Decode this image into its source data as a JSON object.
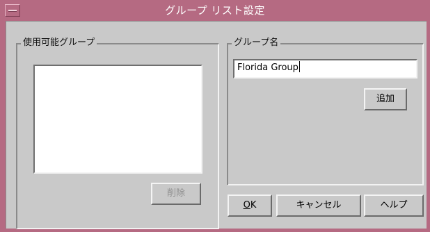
{
  "window": {
    "title": "グループ リスト設定"
  },
  "available_groups": {
    "label": "使用可能グループ",
    "items": [],
    "delete_label": "削除"
  },
  "group_name": {
    "label": "グループ名",
    "value": "Florida Group",
    "add_label": "追加"
  },
  "footer": {
    "ok_label": "OK",
    "cancel_label": "キャンセル",
    "help_label": "ヘルプ"
  }
}
